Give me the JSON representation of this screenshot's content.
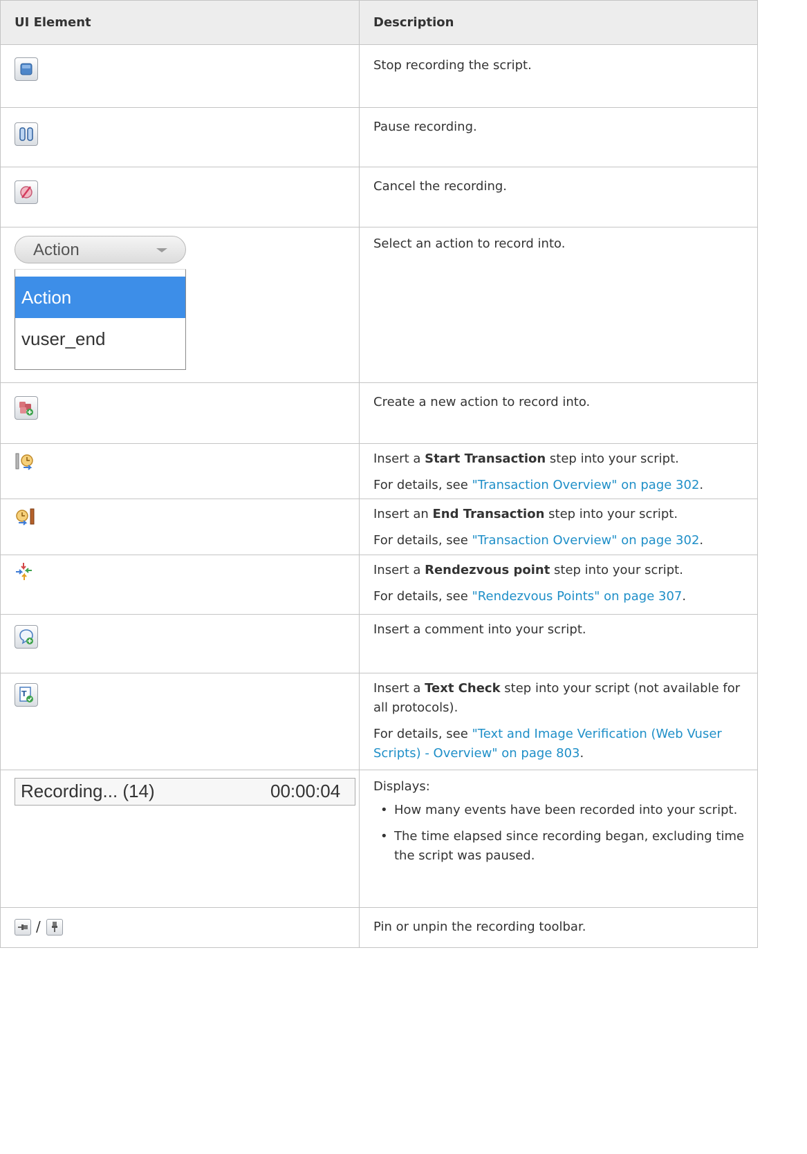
{
  "header": {
    "col1": "UI Element",
    "col2": "Description"
  },
  "rows": {
    "stop": {
      "icon": "stop-icon",
      "text": "Stop recording the script."
    },
    "pause": {
      "icon": "pause-icon",
      "text": "Pause recording."
    },
    "cancel": {
      "icon": "cancel-recording-icon",
      "text": "Cancel the recording."
    },
    "action": {
      "dropdown_value": "Action",
      "options": [
        "Action",
        "vuser_end"
      ],
      "text": "Select an action to record into."
    },
    "new_action": {
      "icon": "new-action-icon",
      "text": "Create a new action to record into."
    },
    "start_tx": {
      "icon": "start-transaction-icon",
      "pre": "Insert a ",
      "bold": "Start Transaction",
      "post": " step into your script.",
      "details_prefix": "For details, see ",
      "link": "\"Transaction Overview\" on page 302",
      "details_suffix": "."
    },
    "end_tx": {
      "icon": "end-transaction-icon",
      "pre": "Insert an ",
      "bold": "End Transaction",
      "post": " step into your script.",
      "details_prefix": "For details, see ",
      "link": "\"Transaction Overview\" on page 302",
      "details_suffix": "."
    },
    "rendezvous": {
      "icon": "rendezvous-icon",
      "pre": "Insert a ",
      "bold": "Rendezvous point",
      "post": " step into your script.",
      "details_prefix": "For details, see ",
      "link": "\"Rendezvous Points\" on page 307",
      "details_suffix": "."
    },
    "comment": {
      "icon": "comment-icon",
      "text": "Insert a comment into your script."
    },
    "textcheck": {
      "icon": "text-check-icon",
      "pre": "Insert a ",
      "bold": "Text Check",
      "post": " step into your script (not available for all protocols).",
      "details_prefix": "For details, see ",
      "link": "\"Text and Image Verification (Web Vuser Scripts) - Overview\" on page 803",
      "details_suffix": "."
    },
    "status": {
      "recording_label": "Recording... (14)",
      "elapsed": "00:00:04",
      "text": "Displays:",
      "bullets": [
        "How many events have been recorded into your script.",
        "The time elapsed since recording began, excluding time the script was paused."
      ]
    },
    "pin": {
      "separator": "/",
      "text": "Pin or unpin the recording toolbar."
    }
  },
  "colors": {
    "link": "#1f8fc8",
    "selected": "#3d8ee8",
    "header_bg": "#ededed",
    "border": "#c4c4c4"
  }
}
